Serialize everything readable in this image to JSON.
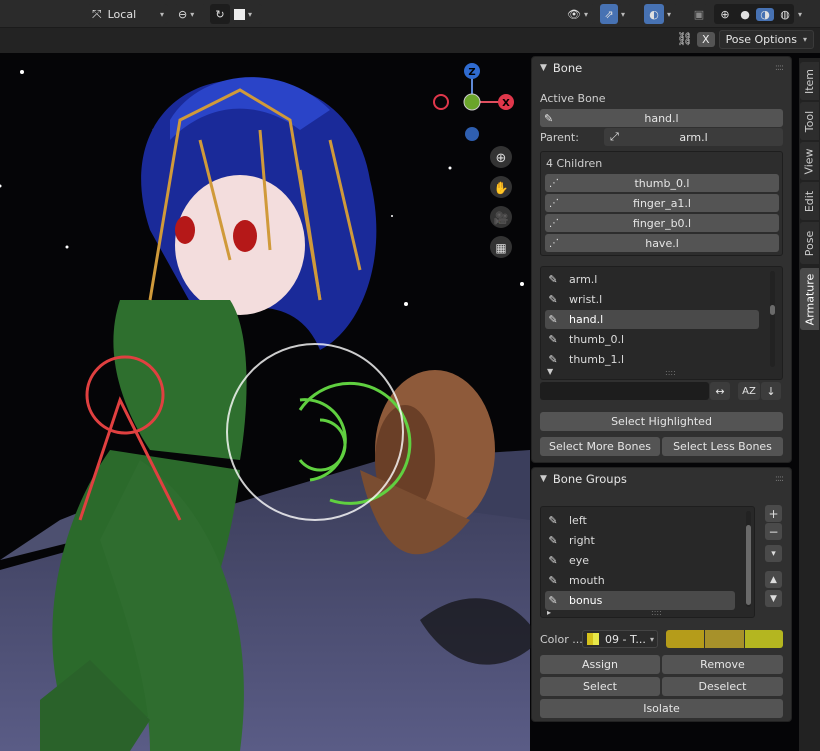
{
  "header": {
    "orientation_label": "Local",
    "x_label": "X",
    "pose_options_label": "Pose Options"
  },
  "sidebar_tabs": [
    "Item",
    "Tool",
    "View",
    "Edit",
    "Pose",
    "Armature"
  ],
  "active_tab": "Armature",
  "gizmo": {
    "z": "Z",
    "x": "X"
  },
  "bone_panel": {
    "title": "Bone",
    "active_bone_label": "Active Bone",
    "active_bone_value": "hand.l",
    "parent_label": "Parent:",
    "parent_value": "arm.l",
    "children_label": "4 Children",
    "children": [
      "thumb_0.l",
      "finger_a1.l",
      "finger_b0.l",
      "have.l"
    ],
    "bone_list": [
      "arm.l",
      "wrist.l",
      "hand.l",
      "thumb_0.l",
      "thumb_1.l"
    ],
    "selected_bone": "hand.l",
    "sort_label": "AZ",
    "select_highlighted": "Select Highlighted",
    "select_more": "Select More Bones",
    "select_less": "Select Less Bones"
  },
  "bone_groups_panel": {
    "title": "Bone Groups",
    "groups": [
      "left",
      "right",
      "eye",
      "mouth",
      "bonus"
    ],
    "selected_group": "bonus",
    "color_label": "Color ...",
    "color_set": "09 - T...",
    "swatches": [
      "#b59c1a",
      "#a7912a",
      "#b4b620"
    ],
    "assign": "Assign",
    "remove": "Remove",
    "select": "Select",
    "deselect": "Deselect",
    "isolate": "Isolate"
  }
}
